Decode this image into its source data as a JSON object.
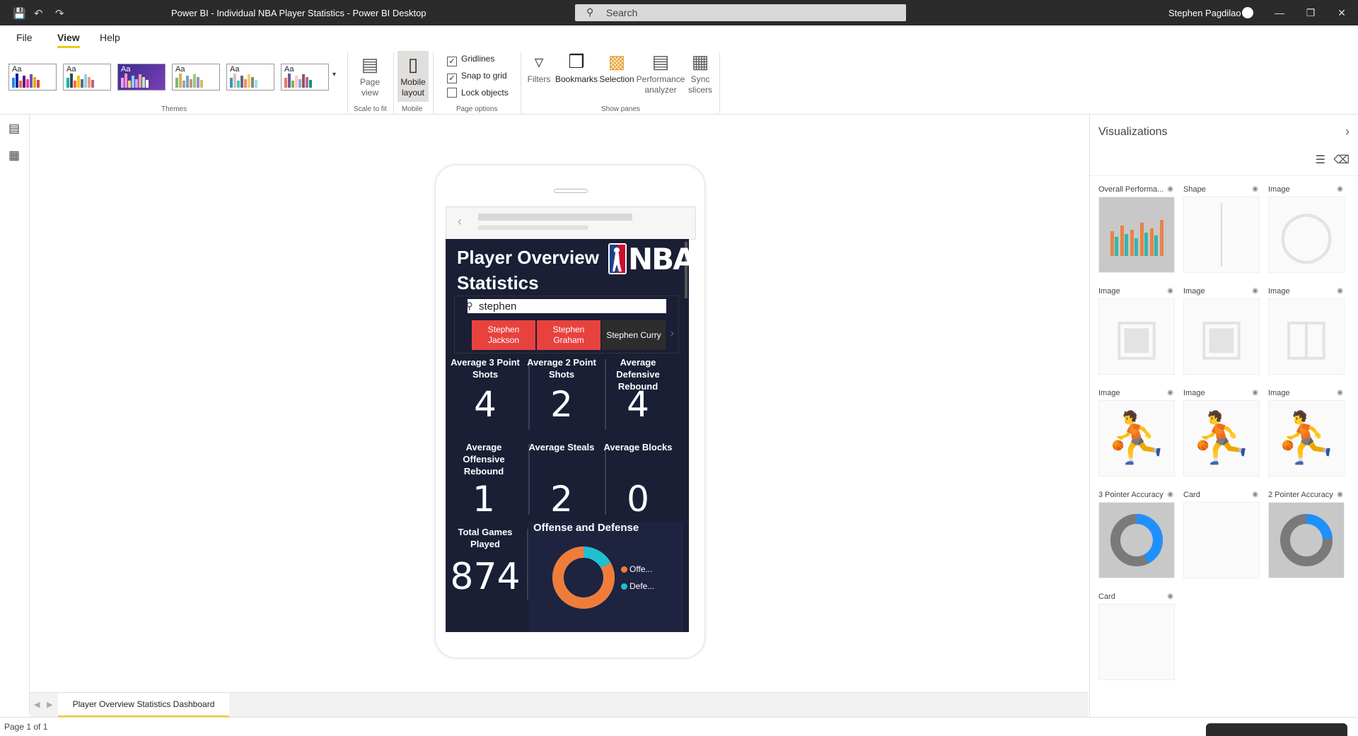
{
  "titlebar": {
    "title": "Power BI - Individual NBA Player Statistics - Power BI Desktop",
    "search_placeholder": "Search",
    "user": "Stephen Pagdilao"
  },
  "ribbon": {
    "tabs": [
      "File",
      "View",
      "Help"
    ],
    "groups": {
      "themes": "Themes",
      "scale_to_fit": "Scale to fit",
      "mobile": "Mobile",
      "page_options": "Page options",
      "show_panes": "Show panes"
    },
    "buttons": {
      "page_view": "Page view",
      "mobile_layout": "Mobile layout",
      "filters": "Filters",
      "bookmarks": "Bookmarks",
      "selection": "Selection",
      "performance": "Performance analyzer",
      "sync_slicers": "Sync slicers"
    },
    "checks": [
      {
        "label": "Gridlines",
        "checked": true
      },
      {
        "label": "Snap to grid",
        "checked": true
      },
      {
        "label": "Lock objects",
        "checked": false
      }
    ]
  },
  "report": {
    "title": "Player Overview Statistics Dashboard",
    "logo_text": "NBA",
    "slicer_value": "stephen",
    "players": [
      {
        "name": "Stephen Jackson",
        "selected": true
      },
      {
        "name": "Stephen Graham",
        "selected": true
      },
      {
        "name": "Stephen Curry",
        "selected": false
      }
    ],
    "kpis": [
      {
        "label": "Average 3 Point Shots",
        "value": "4"
      },
      {
        "label": "Average 2 Point Shots",
        "value": "2"
      },
      {
        "label": "Average Defensive Rebound",
        "value": "4"
      },
      {
        "label": "Average Offensive Rebound",
        "value": "1"
      },
      {
        "label": "Average Steals",
        "value": "2"
      },
      {
        "label": "Average Blocks",
        "value": "0"
      },
      {
        "label": "Total Games Played",
        "value": "874"
      }
    ],
    "donut": {
      "title": "Offense and Defense",
      "legend": [
        {
          "label": "Offe...",
          "color": "#f07c3a"
        },
        {
          "label": "Defe...",
          "color": "#20bfcf"
        }
      ],
      "offense_share": 0.83
    }
  },
  "page_tab": "Player Overview Statistics Dashboard",
  "status": "Page 1 of 1",
  "visualizations": {
    "title": "Visualizations",
    "tiles": [
      {
        "label": "Overall Performa...",
        "icon": "bar-chart-icon"
      },
      {
        "label": "Shape",
        "icon": "line-shape-icon"
      },
      {
        "label": "Image",
        "icon": "shield-icon"
      },
      {
        "label": "Image",
        "icon": "basketball-hoop-icon"
      },
      {
        "label": "Image",
        "icon": "basketball-hoop-icon"
      },
      {
        "label": "Image",
        "icon": "basketball-court-icon"
      },
      {
        "label": "Image",
        "icon": "player-dribble-icon"
      },
      {
        "label": "Image",
        "icon": "player-shoot-icon"
      },
      {
        "label": "Image",
        "icon": "player-shoot-icon"
      },
      {
        "label": "3 Pointer Accuracy",
        "icon": "donut-icon"
      },
      {
        "label": "Card",
        "icon": "card-icon"
      },
      {
        "label": "2 Pointer Accuracy",
        "icon": "donut-icon"
      },
      {
        "label": "Card",
        "icon": "card-icon"
      }
    ]
  },
  "colors": {
    "accent": "#f2c811",
    "report_bg": "#1a1f36",
    "selected_chip": "#e8423f"
  }
}
